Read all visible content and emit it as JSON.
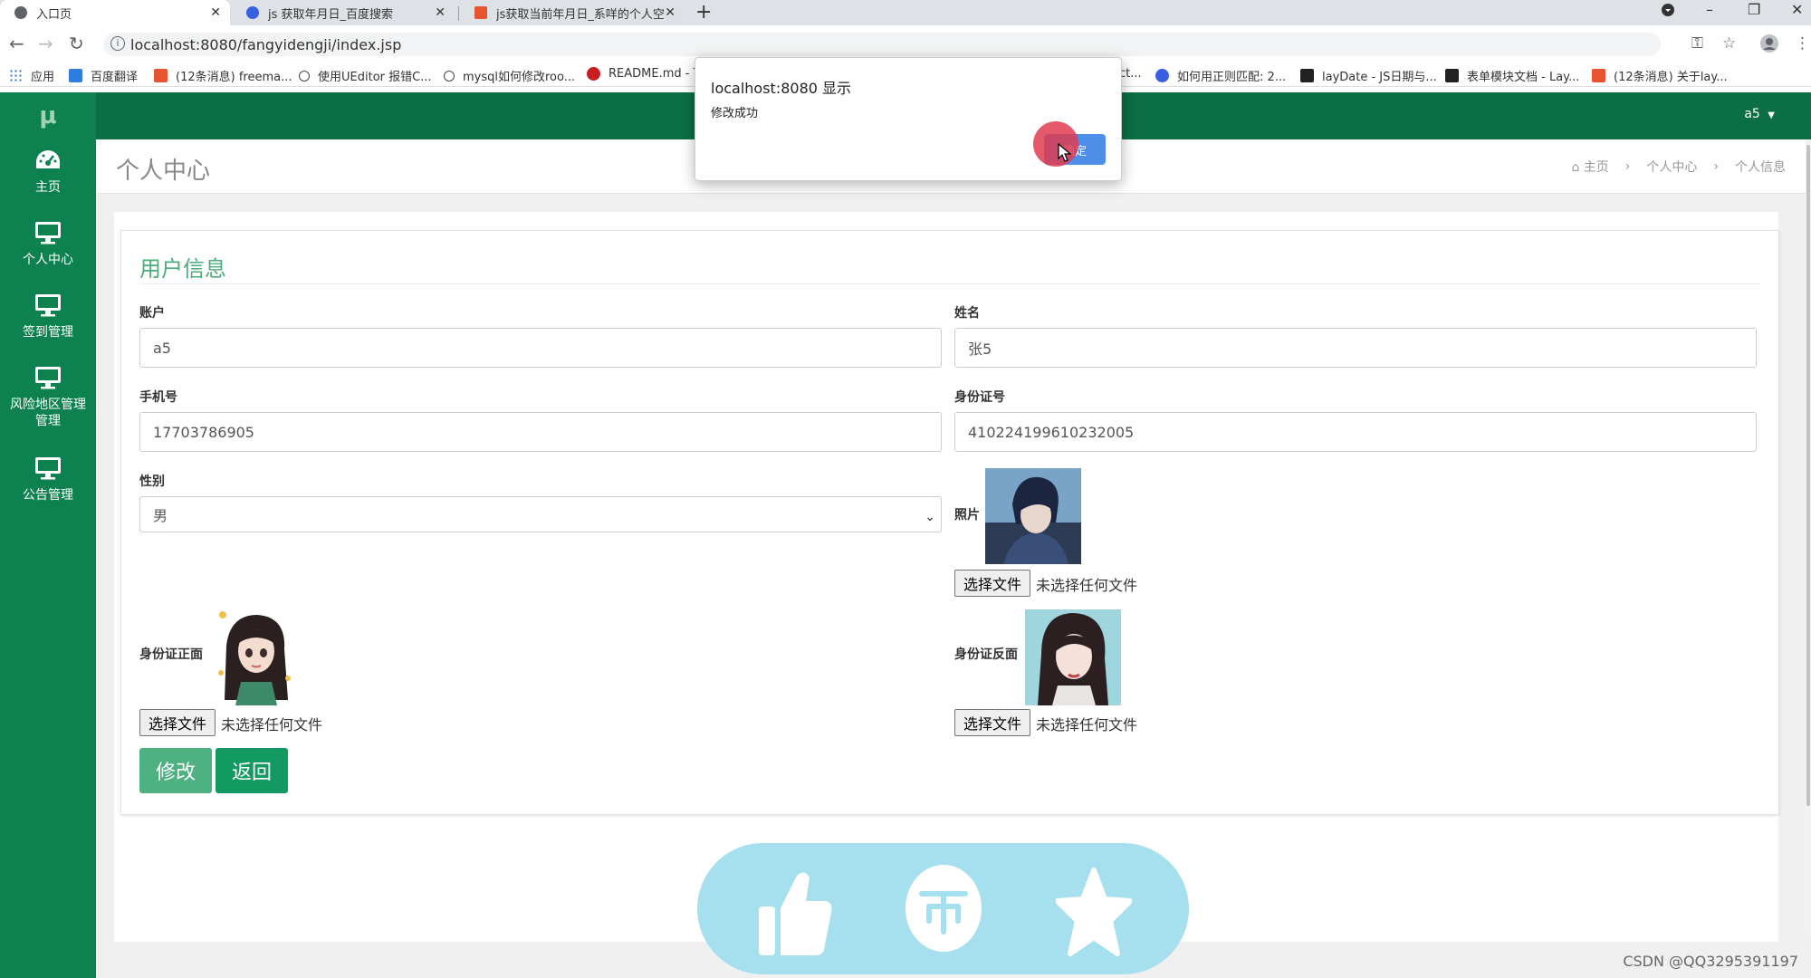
{
  "browser": {
    "tabs": [
      {
        "title": "入口页",
        "active": true
      },
      {
        "title": "js 获取年月日_百度搜索",
        "active": false
      },
      {
        "title": "js获取当前年月日_系咩的个人空间",
        "active": false
      }
    ],
    "url": "localhost:8080/fangyidengji/index.jsp",
    "bookmarks": [
      "应用",
      "百度翻译",
      "(12条消息) freema...",
      "使用UEditor 报错C...",
      "mysql如何修改roo...",
      "README.md - T",
      "ct...",
      "如何用正则匹配: 2...",
      "layDate - JS日期与...",
      "表单模块文档 - Lay...",
      "(12条消息) 关于lay..."
    ]
  },
  "app": {
    "logo": "μ",
    "user": "a5",
    "sidebar": [
      {
        "label": "主页"
      },
      {
        "label": "个人中心"
      },
      {
        "label": "签到管理"
      },
      {
        "label": "风险地区管理管理"
      },
      {
        "label": "公告管理"
      }
    ],
    "page_title": "个人中心",
    "breadcrumb": [
      "主页",
      "个人中心",
      "个人信息"
    ]
  },
  "form": {
    "title": "用户信息",
    "account": {
      "label": "账户",
      "value": "a5"
    },
    "name": {
      "label": "姓名",
      "value": "张5"
    },
    "phone": {
      "label": "手机号",
      "value": "17703786905"
    },
    "idcard": {
      "label": "身份证号",
      "value": "410224199610232005"
    },
    "gender": {
      "label": "性别",
      "value": "男"
    },
    "photo": {
      "label": "照片"
    },
    "id_front": {
      "label": "身份证正面"
    },
    "id_back": {
      "label": "身份证反面"
    },
    "file_button": "选择文件",
    "no_file": "未选择任何文件",
    "submit": "修改",
    "back": "返回"
  },
  "dialog": {
    "title": "localhost:8080 显示",
    "message": "修改成功",
    "ok": "确定"
  },
  "watermark": "CSDN @QQ3295391197",
  "colors": {
    "sidebar": "#0d8250",
    "topbar": "#0b6e44",
    "section_title": "#4cae7c",
    "submit": "#4db182",
    "back": "#129a62",
    "dialog_ok": "#4d8fe8"
  }
}
